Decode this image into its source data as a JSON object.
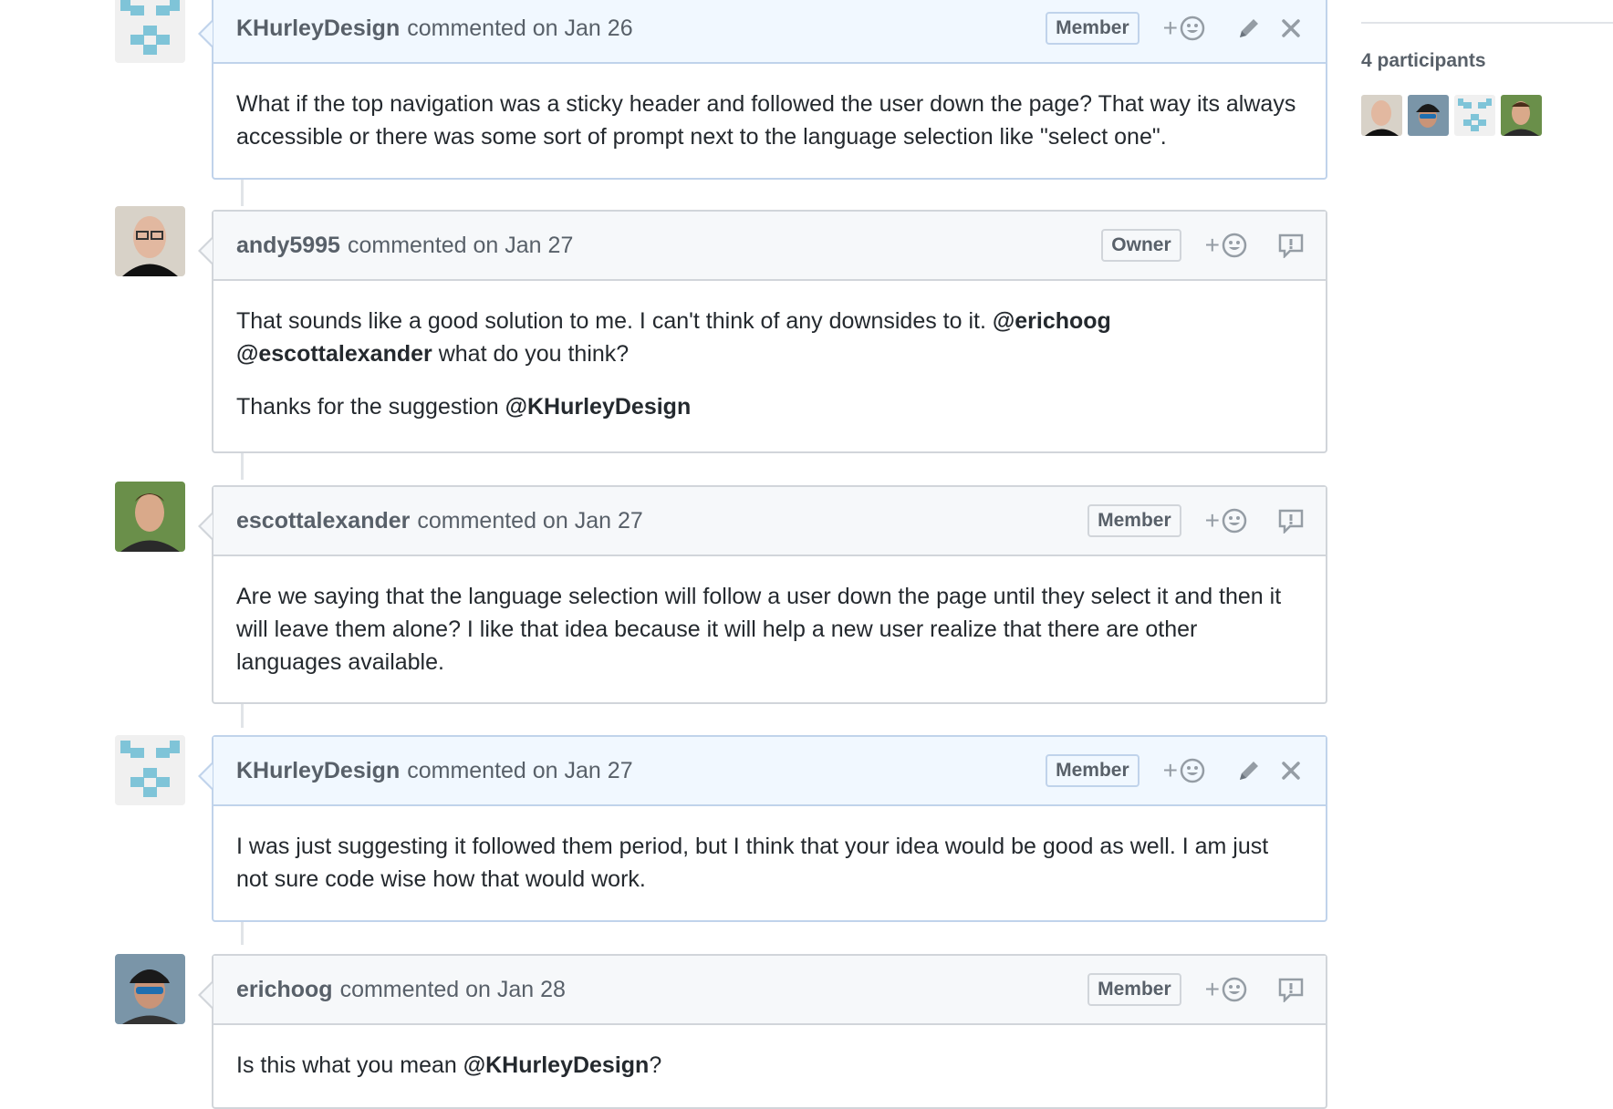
{
  "sidebar": {
    "participants_label": "4 participants"
  },
  "comments": [
    {
      "author": "KHurleyDesign",
      "meta": "commented on Jan 26",
      "badge": "Member",
      "own": true,
      "paragraphs": [
        {
          "text": "What if the top navigation was a sticky header and followed the user down the page? That way its always accessible or there was some sort of prompt next to the language selection like \"select one\"."
        }
      ]
    },
    {
      "author": "andy5995",
      "meta": "commented on Jan 27",
      "badge": "Owner",
      "own": false,
      "p1_text": "That sounds like a good solution to me. I can't think of any downsides to it. ",
      "p1_mention1": "@erichoog",
      "p1_mention2": "@escottalexander",
      "p1_tail": "what do you think?",
      "p2_text": "Thanks for the suggestion ",
      "p2_mention": "@KHurleyDesign"
    },
    {
      "author": "escottalexander",
      "meta": "commented on Jan 27",
      "badge": "Member",
      "own": false,
      "text": "Are we saying that the language selection will follow a user down the page until they select it and then it will leave them alone? I like that idea because it will help a new user realize that there are other languages available."
    },
    {
      "author": "KHurleyDesign",
      "meta": "commented on Jan 27",
      "badge": "Member",
      "own": true,
      "text": "I was just suggesting it followed them period, but I think that your idea would be good as well. I am just not sure code wise how that would work."
    },
    {
      "author": "erichoog",
      "meta": "commented on Jan 28",
      "badge": "Member",
      "own": false,
      "text": "Is this what you mean ",
      "mention": "@KHurleyDesign",
      "tail": "?"
    }
  ],
  "icons": {
    "reaction": "smiley-add-icon",
    "edit": "pencil-icon",
    "delete": "close-icon",
    "report": "report-icon"
  },
  "colors": {
    "own_header_bg": "#f1f8ff",
    "own_border": "#c0d3eb",
    "header_bg": "#f6f8fa",
    "border": "#d1d5da",
    "identicon": "#7fc4d8"
  }
}
